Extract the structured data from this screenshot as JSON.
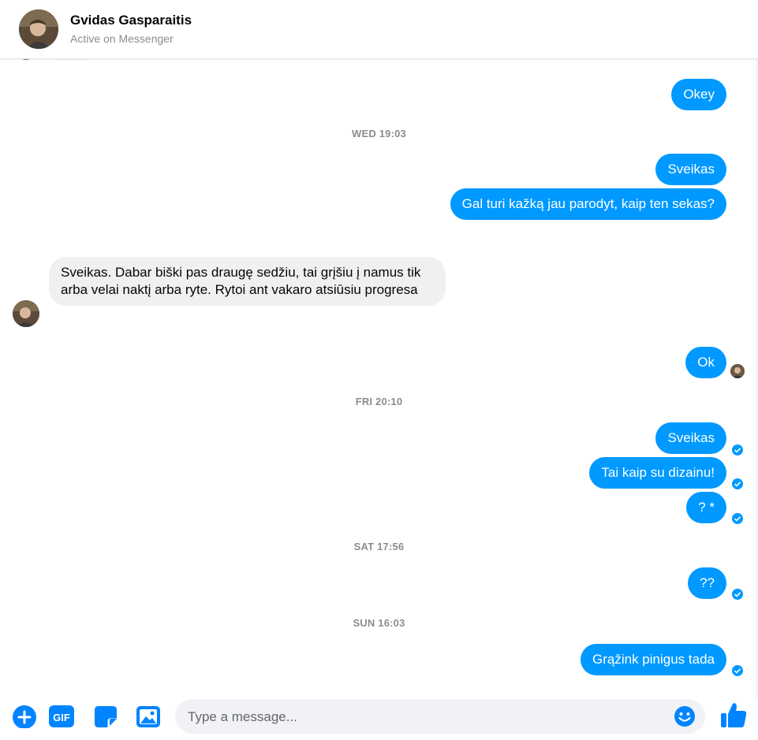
{
  "header": {
    "name": "Gvidas Gasparaitis",
    "status": "Active on Messenger"
  },
  "messages": {
    "m1": "Okey",
    "ts1": "WED 19:03",
    "m2": "Sveikas",
    "m3": "Gal turi kažką jau parodyt, kaip ten sekas?",
    "m4": "Sveikas. Dabar biški pas draugę sedžiu, tai grįšiu į namus tik arba velai naktį arba ryte. Rytoi ant vakaro atsiūsiu progresa",
    "m5": "Ok",
    "ts2": "FRI 20:10",
    "m6": "Sveikas",
    "m7": "Tai kaip su dizainu!",
    "m8": "? *",
    "ts3": "SAT 17:56",
    "m9": "??",
    "ts4": "SUN 16:03",
    "m10": "Grąžink pinigus tada"
  },
  "composer": {
    "placeholder": "Type a message...",
    "icons": [
      "plus-icon",
      "gif-icon",
      "sticker-icon",
      "image-icon",
      "emoji-icon",
      "thumbs-up-icon"
    ]
  },
  "colors": {
    "outgoing_bubble": "#0099ff",
    "incoming_bubble": "#f0f0f0",
    "timestamp": "#8a8d91",
    "accent": "#0084ff"
  }
}
